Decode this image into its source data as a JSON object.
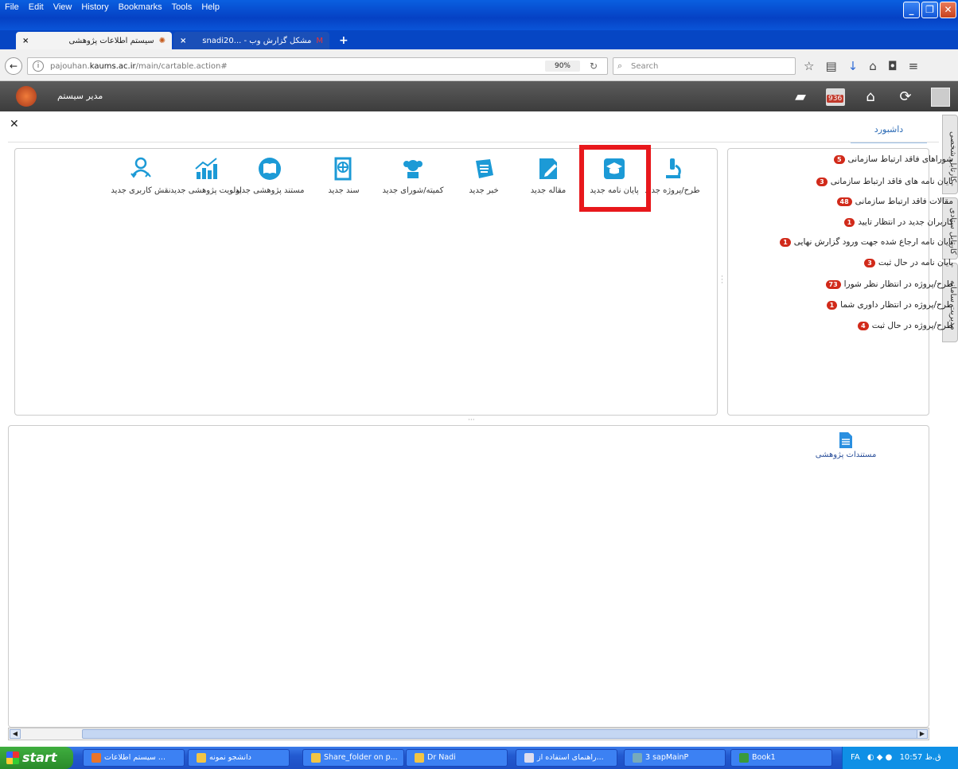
{
  "menu": [
    "File",
    "Edit",
    "View",
    "History",
    "Bookmarks",
    "Tools",
    "Help"
  ],
  "tabs": [
    {
      "title": "سیستم اطلاعات پژوهشی",
      "active": true
    },
    {
      "title": "snadi20... - مشکل گزارش وب",
      "active": false
    }
  ],
  "nav": {
    "url_prefix": "pajouhan.",
    "url_domain": "kaums.ac.ir",
    "url_path": "/main/cartable.action#",
    "zoom": "90%",
    "search_placeholder": "Search"
  },
  "header": {
    "user": "مدیر سیستم",
    "mail_count": "936"
  },
  "dashboard_tab": "داشبورد",
  "side_tabs": [
    "کارتابل شخصی",
    "کارتابل ستادی",
    "مدیریت سامانه"
  ],
  "quick_actions": [
    {
      "label": "طرح/پروژه جدید",
      "icon": "microscope-icon"
    },
    {
      "label": "پایان نامه جدید",
      "icon": "graduation-cap-icon"
    },
    {
      "label": "مقاله جدید",
      "icon": "edit-doc-icon"
    },
    {
      "label": "خبر جدید",
      "icon": "newspaper-icon"
    },
    {
      "label": "کمیته/شورای جدید",
      "icon": "committee-icon"
    },
    {
      "label": "سند جدید",
      "icon": "globe-doc-icon"
    },
    {
      "label": "مستند پژوهشی جدید",
      "icon": "book-icon"
    },
    {
      "label": "اولویت پژوهشی جدید",
      "icon": "chart-icon"
    },
    {
      "label": "نقش کاربری جدید",
      "icon": "user-role-icon"
    }
  ],
  "notices": [
    {
      "text": "شوراهای فاقد ارتباط سازمانی",
      "count": "5"
    },
    {
      "text": "پایان نامه های فاقد ارتباط سازمانی",
      "count": "3"
    },
    {
      "text": "مقالات فاقد ارتباط سازمانی",
      "count": "48"
    },
    {
      "text": "کاربران جدید در انتظار تایید",
      "count": "1"
    },
    {
      "text": "پایان نامه ارجاع شده جهت ورود گزارش نهایی",
      "count": "1"
    },
    {
      "text": "پایان نامه در حال ثبت",
      "count": "3"
    },
    {
      "text": "طرح/پروژه در انتظار نظر شورا",
      "count": "73"
    },
    {
      "text": "طرح/پروژه در انتظار داوری شما",
      "count": "1"
    },
    {
      "text": "طرح/پروژه در حال ثبت",
      "count": "4"
    }
  ],
  "documents_link": "مستندات پژوهشی",
  "taskbar": {
    "start": "start",
    "items": [
      "سیستم اطلاعات ...",
      "دانشجو نمونه",
      "Share_folder on p...",
      "Dr Nadi",
      "راهنمای استفاده از...",
      "3 sapMainP",
      "Book1"
    ],
    "lang": "FA",
    "time": "10:57 ق.ظ"
  }
}
